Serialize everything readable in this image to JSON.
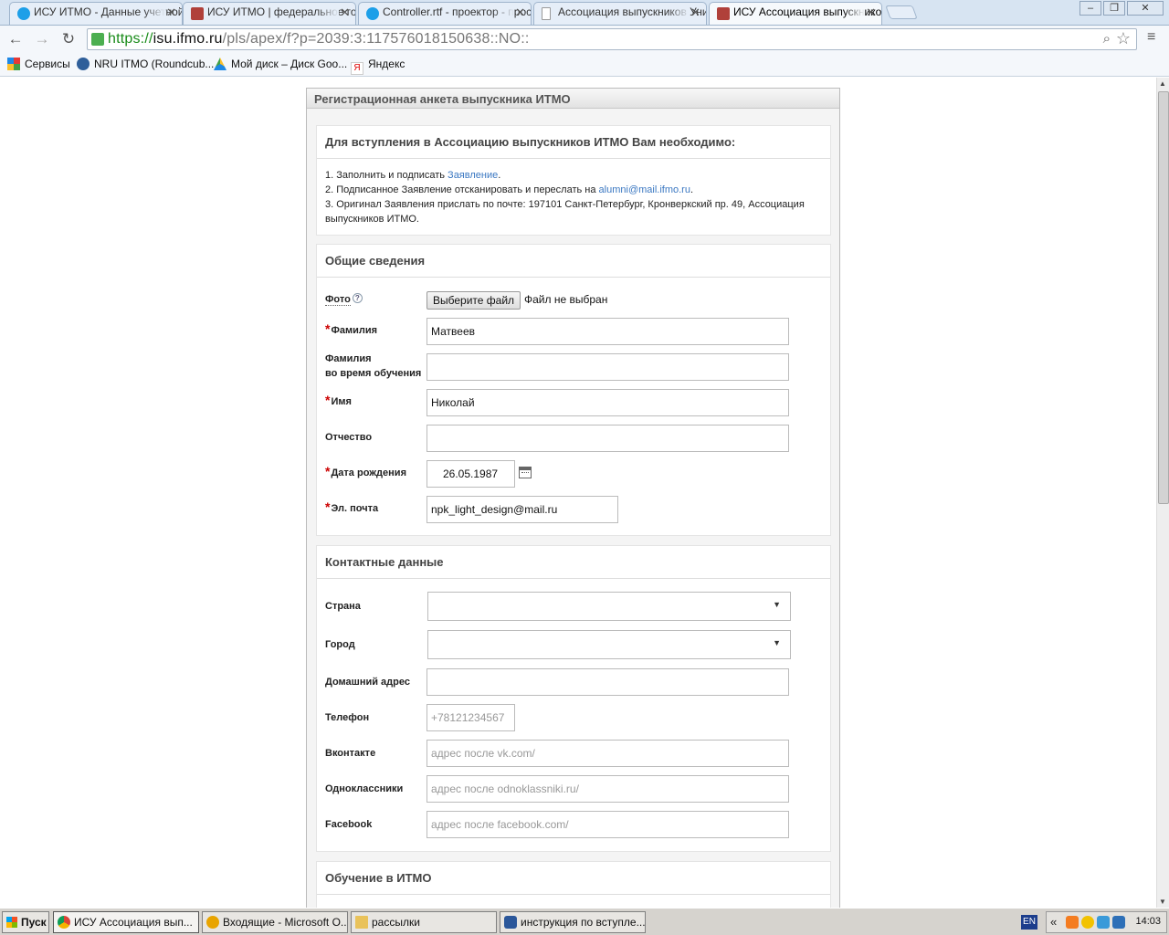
{
  "browser": {
    "tabs": [
      {
        "title": "ИСУ ИТМО - Данные учетной записи",
        "color": "#1d9fe8"
      },
      {
        "title": "ИСУ ИТМО | федеральное государственное",
        "color": "#b0403a"
      },
      {
        "title": "Controller.rtf - проектор - просмотр",
        "color": "#1d9fe8"
      },
      {
        "title": "Ассоциация выпускников Университета ИТМО",
        "color": "#ffffff"
      },
      {
        "title": "ИСУ Ассоциация выпускников",
        "color": "#b0403a"
      }
    ],
    "url_scheme": "https://",
    "url_host": "isu.ifmo.ru",
    "url_path": "/pls/apex/f?p=2039:3:117576018150638::NO::",
    "bookmarks": [
      {
        "label": "Сервисы"
      },
      {
        "label": "NRU ITMO (Roundcub..."
      },
      {
        "label": "Мой диск – Диск Goo..."
      },
      {
        "label": "Яндекс"
      }
    ]
  },
  "form": {
    "region_title": "Регистрационная анкета выпускника ИТМО",
    "intro": {
      "title": "Для вступления в Ассоциацию выпускников ИТМО Вам необходимо:",
      "line1_prefix": "1. Заполнить и подписать ",
      "line1_link": "Заявление",
      "line1_suffix": ".",
      "line2_prefix": "2. Подписанное Заявление отсканировать и переслать на ",
      "line2_link": "alumni@mail.ifmo.ru",
      "line2_suffix": ".",
      "line3": "3. Оригинал Заявления прислать по почте: 197101 Санкт-Петербург, Кронверкский пр. 49, Ассоциация выпускников  ИТМО."
    },
    "general": {
      "title": "Общие сведения",
      "photo_label": "Фото",
      "help_glyph": "?",
      "file_button": "Выберите файл",
      "file_status": "Файл не выбран",
      "required_mark": "*",
      "lastname_label": "Фамилия",
      "lastname_value": "Матвеев",
      "lastname_study_label_1": "Фамилия",
      "lastname_study_label_2": "во время обучения",
      "lastname_study_value": "",
      "firstname_label": "Имя",
      "firstname_value": "Николай",
      "patronymic_label": "Отчество",
      "patronymic_value": "",
      "birthdate_label": "Дата рождения",
      "birthdate_value": "26.05.1987",
      "email_label": "Эл. почта",
      "email_value": "npk_light_design@mail.ru"
    },
    "contacts": {
      "title": "Контактные данные",
      "country_label": "Страна",
      "country_value": "",
      "city_label": "Город",
      "city_value": "",
      "address_label": "Домашний адрес",
      "address_value": "",
      "phone_label": "Телефон",
      "phone_placeholder": "+78121234567",
      "vk_label": "Вконтакте",
      "vk_placeholder": "адрес после vk.com/",
      "ok_label": "Одноклассники",
      "ok_placeholder": "адрес после odnoklassniki.ru/",
      "fb_label": "Facebook",
      "fb_placeholder": "адрес после facebook.com/"
    },
    "education": {
      "title": "Обучение в ИТМО"
    }
  },
  "taskbar": {
    "start_label": "Пуск",
    "tasks": [
      {
        "label": "ИСУ Ассоциация вып...",
        "color": "#db4437"
      },
      {
        "label": "Входящие - Microsoft O...",
        "color": "#e8a400"
      },
      {
        "label": "рассылки",
        "color": "#e9c25a"
      },
      {
        "label": "инструкция по вступле...",
        "color": "#2b579a"
      }
    ],
    "lang": "EN",
    "tray_chevron": "«",
    "clock": "14:03"
  }
}
